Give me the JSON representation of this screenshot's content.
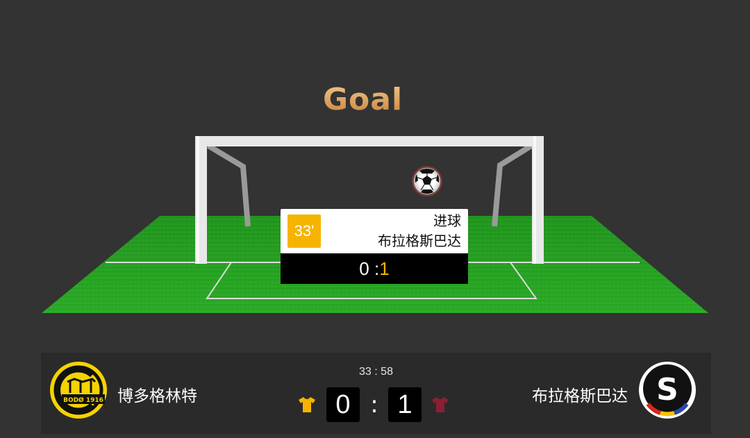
{
  "overlay": {
    "title": "Goal"
  },
  "event": {
    "minute": "33'",
    "type": "进球",
    "team": "布拉格斯巴达",
    "score_home": "0",
    "score_sep": " :",
    "score_away": "1"
  },
  "match": {
    "clock": "33 : 58",
    "home": {
      "name": "博多格林特",
      "score": "0",
      "jersey_color": "#f5b400",
      "logo_text": "BODØ 1916"
    },
    "away": {
      "name": "布拉格斯巴达",
      "score": "1",
      "jersey_color": "#8b1f33",
      "logo_letter": "S"
    },
    "separator": ":"
  },
  "colors": {
    "background": "#333333",
    "pitch": "#2a9a24",
    "accent": "#f5b400"
  }
}
